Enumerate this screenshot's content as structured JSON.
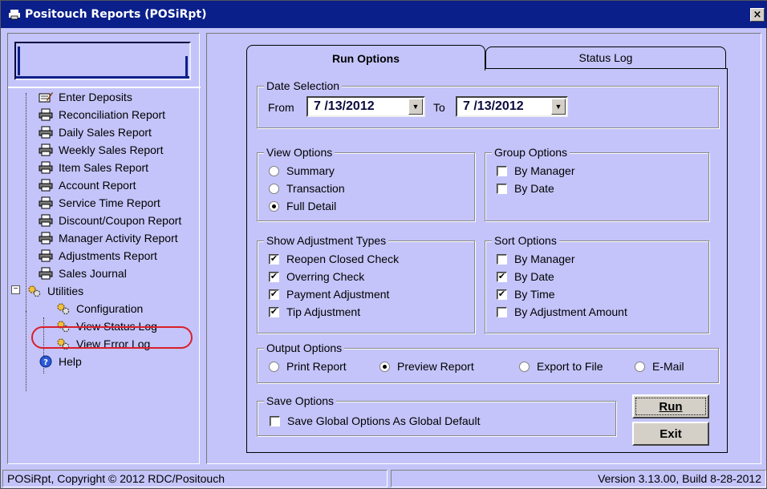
{
  "window": {
    "title": "Positouch Reports (POSiRpt)",
    "close_glyph": "×"
  },
  "tree": {
    "items": [
      {
        "label": "Enter Deposits",
        "icon": "deposit-icon"
      },
      {
        "label": "Reconciliation Report",
        "icon": "printer-icon"
      },
      {
        "label": "Daily Sales Report",
        "icon": "printer-icon"
      },
      {
        "label": "Weekly Sales Report",
        "icon": "printer-icon"
      },
      {
        "label": "Item Sales Report",
        "icon": "printer-icon"
      },
      {
        "label": "Account Report",
        "icon": "printer-icon"
      },
      {
        "label": "Service Time Report",
        "icon": "printer-icon"
      },
      {
        "label": "Discount/Coupon Report",
        "icon": "printer-icon"
      },
      {
        "label": "Manager Activity Report",
        "icon": "printer-icon"
      },
      {
        "label": "Adjustments Report",
        "icon": "printer-icon"
      },
      {
        "label": "Sales Journal",
        "icon": "printer-icon"
      },
      {
        "label": "Utilities",
        "icon": "gears-icon"
      },
      {
        "label": "Configuration",
        "icon": "gears-icon"
      },
      {
        "label": "View Status Log",
        "icon": "gears-icon"
      },
      {
        "label": "View Error Log",
        "icon": "gears-icon"
      },
      {
        "label": "Help",
        "icon": "help-icon"
      }
    ],
    "expander": "−"
  },
  "tabs": {
    "run_options": "Run Options",
    "status_log": "Status Log"
  },
  "date_selection": {
    "legend": "Date Selection",
    "from_label": "From",
    "from_value": "7 /13/2012",
    "to_label": "To",
    "to_value": "7 /13/2012"
  },
  "view_options": {
    "legend": "View Options",
    "options": [
      {
        "label": "Summary",
        "selected": false
      },
      {
        "label": "Transaction",
        "selected": false
      },
      {
        "label": "Full Detail",
        "selected": true
      }
    ]
  },
  "group_options": {
    "legend": "Group Options",
    "options": [
      {
        "label": "By Manager",
        "checked": false
      },
      {
        "label": "By Date",
        "checked": false
      }
    ]
  },
  "adjustment_types": {
    "legend": "Show Adjustment Types",
    "options": [
      {
        "label": "Reopen Closed Check",
        "checked": true
      },
      {
        "label": "Overring Check",
        "checked": true
      },
      {
        "label": "Payment Adjustment",
        "checked": true
      },
      {
        "label": "Tip Adjustment",
        "checked": true
      }
    ]
  },
  "sort_options": {
    "legend": "Sort Options",
    "options": [
      {
        "label": "By Manager",
        "checked": false
      },
      {
        "label": "By Date",
        "checked": true
      },
      {
        "label": "By Time",
        "checked": true
      },
      {
        "label": "By Adjustment Amount",
        "checked": false
      }
    ]
  },
  "output_options": {
    "legend": "Output Options",
    "options": [
      {
        "label": "Print Report",
        "selected": false
      },
      {
        "label": "Preview Report",
        "selected": true
      },
      {
        "label": "Export to File",
        "selected": false
      },
      {
        "label": "E-Mail",
        "selected": false
      }
    ]
  },
  "save_options": {
    "legend": "Save Options",
    "option": {
      "label": "Save Global Options As Global Default",
      "checked": false
    }
  },
  "buttons": {
    "run": "Run",
    "exit": "Exit"
  },
  "status": {
    "copyright": "POSiRpt, Copyright © 2012 RDC/Positouch",
    "version": "Version 3.13.00, Build 8-28-2012"
  },
  "colors": {
    "titlebar": "#0a1f8a",
    "background": "#c4c4fa",
    "highlight_ring": "#d8202a"
  }
}
